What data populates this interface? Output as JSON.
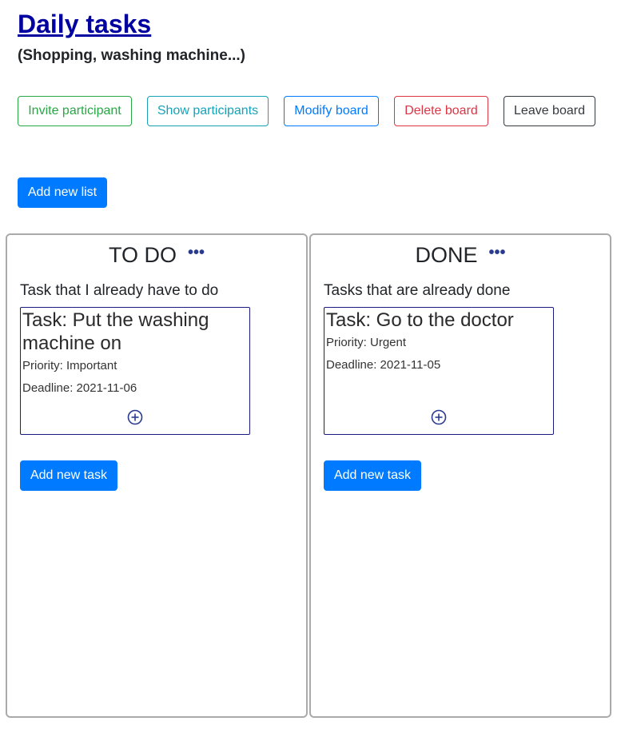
{
  "board": {
    "title": "Daily tasks",
    "description": "(Shopping, washing machine...)"
  },
  "toolbar": {
    "invite": "Invite participant",
    "show": "Show participants",
    "modify": "Modify board",
    "delete": "Delete board",
    "leave": "Leave board"
  },
  "add_list_label": "Add new list",
  "lists": [
    {
      "title": "TO DO",
      "menu_icon": "more-dots-icon",
      "description": "Task that I already have to do",
      "cards": [
        {
          "title": "Task: Put the washing machine on",
          "priority": "Priority: Important",
          "deadline": "Deadline: 2021-11-06",
          "add_icon": "plus-circle-icon"
        }
      ],
      "add_task_label": "Add new task"
    },
    {
      "title": "DONE",
      "menu_icon": "more-dots-icon",
      "description": "Tasks that are already done",
      "cards": [
        {
          "title": "Task: Go to the doctor",
          "priority": "Priority: Urgent",
          "deadline": "Deadline: 2021-11-05",
          "add_icon": "plus-circle-icon"
        }
      ],
      "add_task_label": "Add new task"
    }
  ],
  "colors": {
    "title_link": "#0000a0",
    "primary": "#007bff",
    "success": "#28a745",
    "info": "#17a2b8",
    "danger": "#dc3545",
    "dark": "#343a40",
    "card_border": "#1a1a80"
  }
}
